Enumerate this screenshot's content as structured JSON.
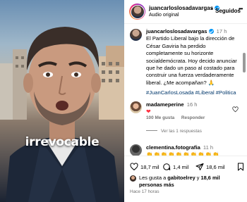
{
  "video": {
    "caption": "irrevocable"
  },
  "header": {
    "username": "juancarloslosadavargas",
    "audio": "Audio original",
    "separator": "•",
    "follow_label": "Seguidos",
    "more_label": "•••"
  },
  "caption_post": {
    "username": "juancarloslosadavargas",
    "time": "17 h",
    "lines": [
      "El Partido Liberal bajo la dirección de",
      "César Gaviria ha perdido",
      "completamente su horizonte",
      "socialdemócrata. Hoy decido anunciar",
      "que he dado un paso al costado para",
      "construir una fuerza verdaderamente",
      "liberal. ¿Me acompañan? 🙏"
    ],
    "hashtags": "#JuanCarlosLosada #Liberal #Politica"
  },
  "comments": [
    {
      "username": "madameperine",
      "time": "16 h",
      "text": "❤",
      "likes": "100 Me gusta",
      "reply_label": "Responder",
      "view_replies": "Ver las 1 respuestas"
    },
    {
      "username": "clementina.fotografia",
      "time": "11 h",
      "text": "👏👏👏👏👏👏👏👏👏👏"
    }
  ],
  "actions": {
    "likes_count": "18,7 mil",
    "comments_count": "1,4 mil",
    "shares_count": "18,6 mil"
  },
  "likes_summary": {
    "prefix": "Les gusta a ",
    "user": "gabitoelrey",
    "middle": " y ",
    "count": "18,6 mil",
    "suffix": "personas más"
  },
  "time_ago": "Hace 17 horas",
  "colors": {
    "verified": "#0095f6",
    "link": "#00376b",
    "heart": "#ff3040",
    "muted": "#737373"
  }
}
